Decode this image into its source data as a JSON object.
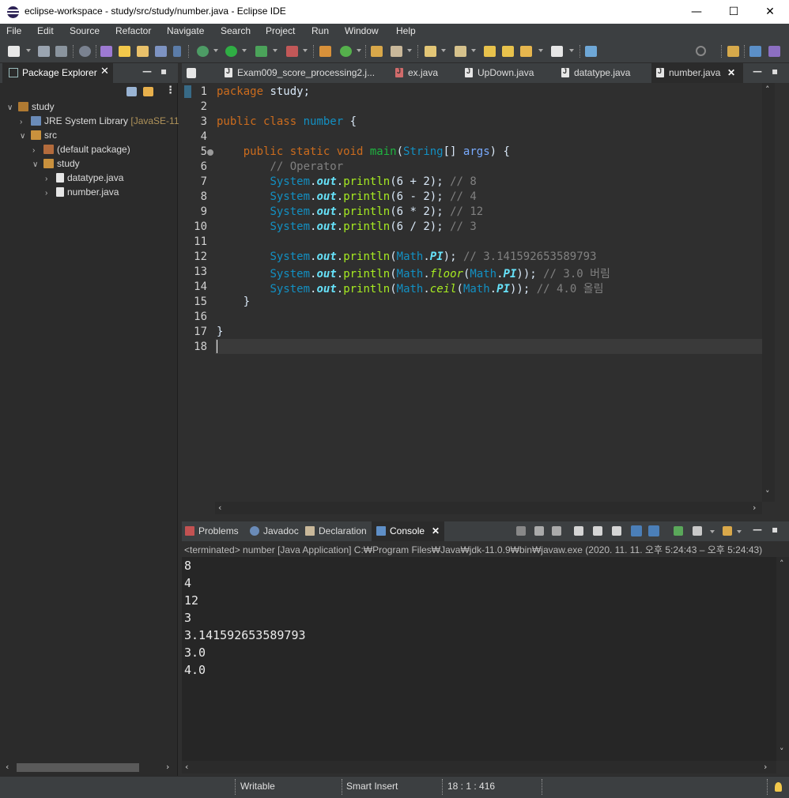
{
  "window": {
    "title": "eclipse-workspace - study/src/study/number.java - Eclipse IDE",
    "minimize": "—",
    "maximize": "☐",
    "close": "✕"
  },
  "menu": [
    "File",
    "Edit",
    "Source",
    "Refactor",
    "Navigate",
    "Search",
    "Project",
    "Run",
    "Window",
    "Help"
  ],
  "package_explorer": {
    "tab_label": "Package Explorer",
    "close": "✕",
    "tree": [
      {
        "arrow": "∨",
        "label": "study",
        "decor": "",
        "icon_color": "#b07a32"
      },
      {
        "arrow": "›",
        "label": "JRE System Library",
        "decor": " [JavaSE-11",
        "icon_color": "#6a8bb8"
      },
      {
        "arrow": "∨",
        "label": "src",
        "decor": "",
        "icon_color": "#c9913d"
      },
      {
        "arrow": "›",
        "label": "(default package)",
        "decor": "",
        "icon_color": "#b36b3c"
      },
      {
        "arrow": "∨",
        "label": "study",
        "decor": "",
        "icon_color": "#c9913d"
      },
      {
        "arrow": "›",
        "label": "datatype.java",
        "decor": "",
        "icon_color": "#e6e6e6"
      },
      {
        "arrow": "›",
        "label": "number.java",
        "decor": "",
        "icon_color": "#e6e6e6"
      }
    ]
  },
  "editor": {
    "tabs": [
      {
        "label": "Exam009_score_processing2.j...",
        "active": false
      },
      {
        "label": "ex.java",
        "active": false
      },
      {
        "label": "UpDown.java",
        "active": false
      },
      {
        "label": "datatype.java",
        "active": false
      },
      {
        "label": "number.java",
        "active": true
      }
    ],
    "tab_close": "✕",
    "line_numbers": [
      "1",
      "2",
      "3",
      "4",
      "5",
      "6",
      "7",
      "8",
      "9",
      "10",
      "11",
      "12",
      "13",
      "14",
      "15",
      "16",
      "17",
      "18"
    ],
    "code": {
      "l1_kw": "package",
      "l1_rest": " study;",
      "l3_kw": "public class",
      "l3_name": " number",
      "l3_rest": " {",
      "l5_indent": "    ",
      "l5_kw": "public static void",
      "l5_sp": " ",
      "l5_main": "main",
      "l5_paren": "(",
      "l5_type": "String",
      "l5_br": "[] ",
      "l5_arg": "args",
      "l5_end": ") {",
      "l6_indent": "        ",
      "l6_cm": "// Operator",
      "sys": "System",
      "dot": ".",
      "out": "out",
      "println": "println",
      "l7_args": "(6 + 2);",
      "l7_cm": " // 8",
      "l8_args": "(6 - 2);",
      "l8_cm": " // 4",
      "l9_args": "(6 * 2);",
      "l9_cm": " // 12",
      "l10_args": "(6 / 2);",
      "l10_cm": " // 3",
      "math": "Math",
      "pi": "PI",
      "floor": "floor",
      "ceil": "ceil",
      "l12_cm": " // 3.141592653589793",
      "l13_cm": " // 3.0 버림",
      "l14_cm": " // 4.0 올림",
      "l15": "    }",
      "l17": "}"
    }
  },
  "console": {
    "tabs": [
      "Problems",
      "Javadoc",
      "Declaration",
      "Console"
    ],
    "close": "✕",
    "status": "<terminated> number [Java Application] C:₩Program Files₩Java₩jdk-11.0.9₩bin₩javaw.exe  (2020. 11. 11. 오후 5:24:43 – 오후 5:24:43)",
    "output": [
      "8",
      "4",
      "12",
      "3",
      "3.141592653589793",
      "3.0",
      "4.0"
    ]
  },
  "statusbar": {
    "mode": "Writable",
    "insert": "Smart Insert",
    "position": "18 : 1 : 416"
  }
}
